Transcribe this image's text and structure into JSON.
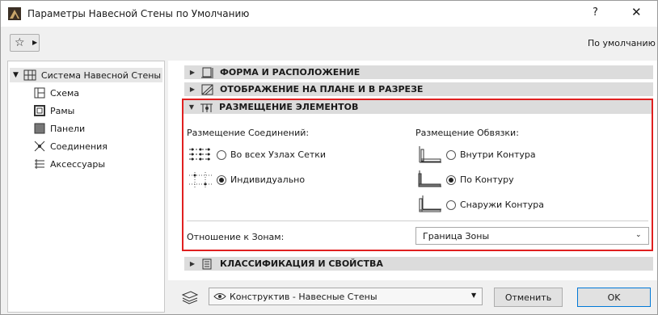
{
  "window": {
    "title": "Параметры Навесной Стены по Умолчанию",
    "help_label": "?",
    "close_label": "✕"
  },
  "toolbar": {
    "favorites_icon": "star-icon",
    "default_label": "По умолчанию"
  },
  "tree": {
    "root": "Система Навесной Стены",
    "items": [
      {
        "label": "Схема",
        "icon": "scheme-icon"
      },
      {
        "label": "Рамы",
        "icon": "frames-icon"
      },
      {
        "label": "Панели",
        "icon": "panels-icon"
      },
      {
        "label": "Соединения",
        "icon": "junctions-icon"
      },
      {
        "label": "Аксессуары",
        "icon": "accessories-icon"
      }
    ]
  },
  "sections": {
    "form": "ФОРМА И РАСПОЛОЖЕНИЕ",
    "plan": "ОТОБРАЖЕНИЕ НА ПЛАНЕ И В РАЗРЕЗЕ",
    "placement": "РАЗМЕЩЕНИЕ ЭЛЕМЕНТОВ",
    "classification": "КЛАССИФИКАЦИЯ И СВОЙСТВА"
  },
  "placement": {
    "junctions_title": "Размещение Соединений:",
    "junction_options": [
      {
        "label": "Во всех Узлах Сетки",
        "checked": false
      },
      {
        "label": "Индивидуально",
        "checked": true
      }
    ],
    "boundary_title": "Размещение Обвязки:",
    "boundary_options": [
      {
        "label": "Внутри Контура",
        "checked": false
      },
      {
        "label": "По Контуру",
        "checked": true
      },
      {
        "label": "Снаружи Контура",
        "checked": false
      }
    ],
    "zone_label": "Отношение к Зонам:",
    "zone_value": "Граница Зоны"
  },
  "footer": {
    "layer_value": "Конструктив - Навесные Стены",
    "cancel_label": "Отменить",
    "ok_label": "OK"
  },
  "colors": {
    "highlight_border": "#e02020",
    "section_header": "#dcdcdc",
    "ok_border": "#0078d7"
  }
}
